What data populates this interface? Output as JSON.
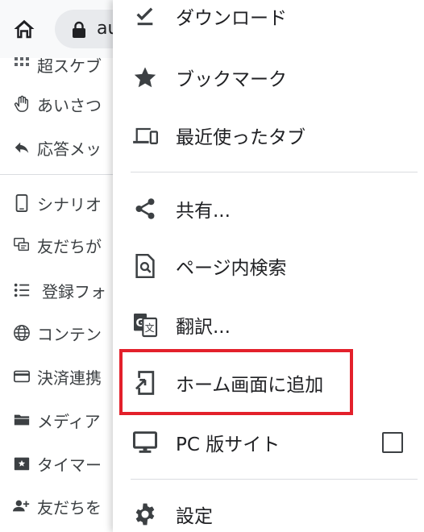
{
  "browser": {
    "url_text": "au"
  },
  "sidebar": {
    "items": [
      {
        "label": "超スケブ",
        "icon": "grid-icon"
      },
      {
        "label": "あいさつ",
        "icon": "hand-icon"
      },
      {
        "label": "応答メッ",
        "icon": "reply-icon"
      },
      {
        "label": "シナリオ",
        "icon": "phone-icon"
      },
      {
        "label": "友だちが",
        "icon": "chat-icon"
      },
      {
        "label": "登録フォ",
        "icon": "list-icon"
      },
      {
        "label": "コンテン",
        "icon": "globe-icon"
      },
      {
        "label": "決済連携",
        "icon": "card-icon"
      },
      {
        "label": "メディア",
        "icon": "folder-icon"
      },
      {
        "label": "タイマー",
        "icon": "timer-icon"
      },
      {
        "label": "友だちを",
        "icon": "add-person-icon"
      }
    ]
  },
  "menu": {
    "download": "ダウンロード",
    "bookmarks": "ブックマーク",
    "recent_tabs": "最近使ったタブ",
    "share": "共有...",
    "find_in_page": "ページ内検索",
    "translate": "翻訳...",
    "add_to_home": "ホーム画面に追加",
    "desktop_site": "PC 版サイト",
    "settings": "設定"
  },
  "colors": {
    "highlight": "#e3202b",
    "icon": "#3c4043"
  }
}
